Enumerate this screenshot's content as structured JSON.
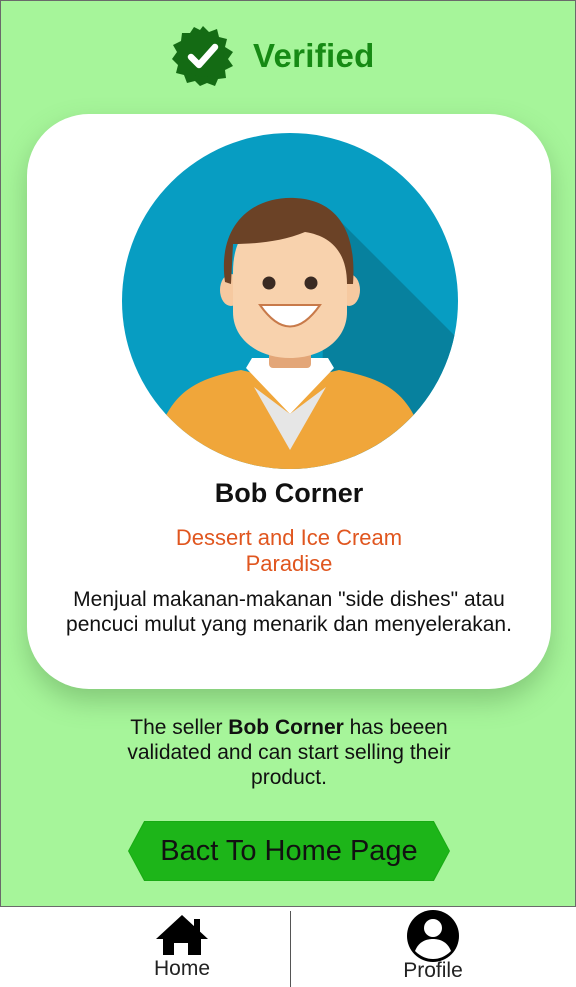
{
  "header": {
    "status_label": "Verified",
    "badge_icon": "verified-badge-icon",
    "status_color": "#168a14"
  },
  "card": {
    "avatar_icon": "male-avatar-illustration",
    "seller_name": "Bob Corner",
    "store_name": "Dessert and Ice Cream Paradise",
    "description": "Menjual makanan-makanan \"side dishes\" atau pencuci mulut yang menarik dan menyelerakan."
  },
  "message": {
    "prefix": "The seller ",
    "seller_name": "Bob Corner",
    "suffix": " has beeen validated and can start selling their product."
  },
  "actions": {
    "back_button_label": "Bact To Home Page",
    "accent_color": "#1db519"
  },
  "bottom_nav": {
    "items": [
      {
        "label": "Home",
        "icon": "home-icon"
      },
      {
        "label": "Profile",
        "icon": "profile-icon"
      }
    ]
  },
  "colors": {
    "background": "#a6f59a",
    "store_name": "#e0561f"
  }
}
